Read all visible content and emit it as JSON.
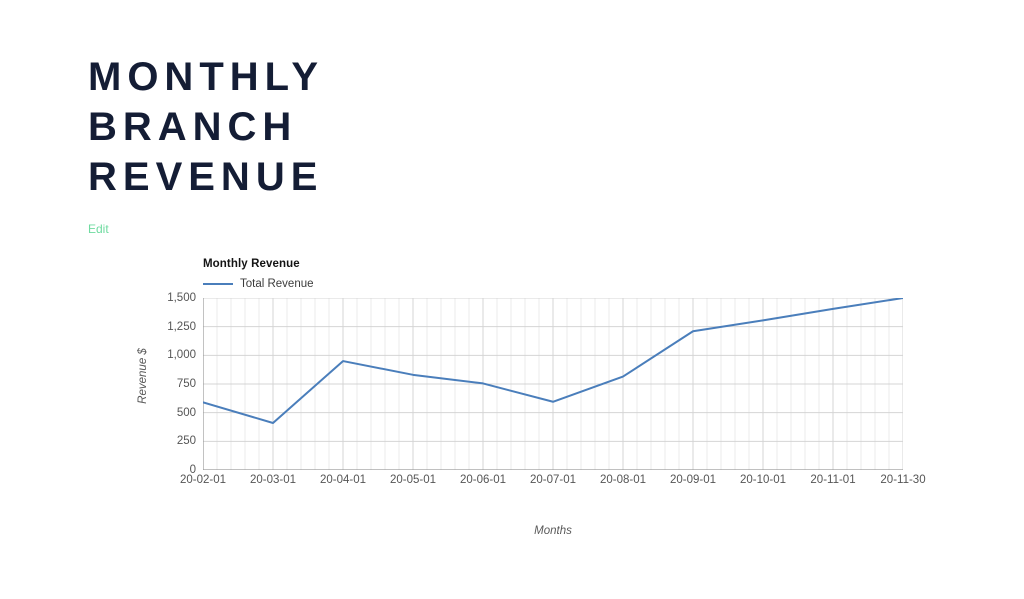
{
  "page": {
    "title": "Monthly Branch Revenue",
    "edit_label": "Edit"
  },
  "chart_data": {
    "type": "line",
    "title": "Monthly Revenue",
    "xlabel": "Months",
    "ylabel": "Revenue $",
    "categories": [
      "20-02-01",
      "20-03-01",
      "20-04-01",
      "20-05-01",
      "20-06-01",
      "20-07-01",
      "20-08-01",
      "20-09-01",
      "20-10-01",
      "20-11-01",
      "20-11-30"
    ],
    "series": [
      {
        "name": "Total Revenue",
        "color": "#4a7ebb",
        "values": [
          590,
          410,
          950,
          830,
          755,
          595,
          815,
          1210,
          1305,
          1405,
          1500
        ]
      }
    ],
    "ylim": [
      0,
      1500
    ],
    "yticks": [
      0,
      250,
      500,
      750,
      1000,
      1250,
      1500
    ],
    "ytick_labels": [
      "0",
      "250",
      "500",
      "750",
      "1,000",
      "1,250",
      "1,500"
    ],
    "grid": true,
    "minor_gridlines_per_interval": 5,
    "legend_position": "top-left",
    "legend": [
      "Total Revenue"
    ]
  }
}
